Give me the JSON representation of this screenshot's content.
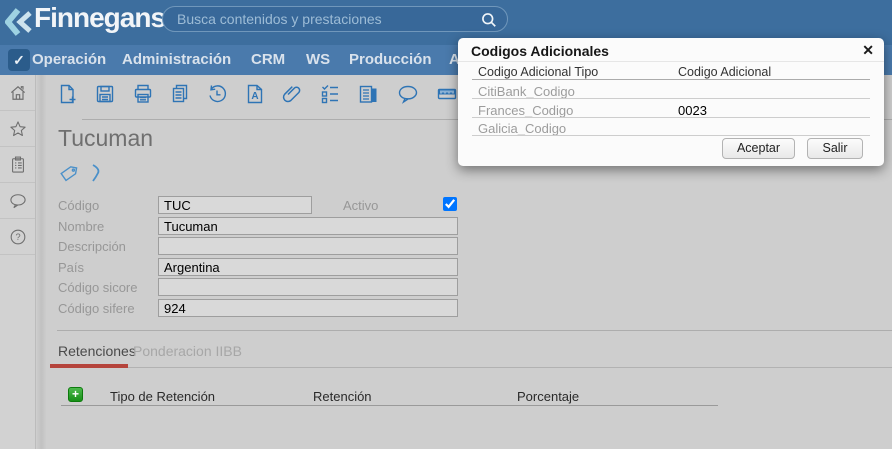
{
  "colors": {
    "header_bg": "#3d6e9e",
    "nav_bg": "#4a7aac",
    "content_bg": "#cecece",
    "toolbar_icon_blue": "#2e74b5",
    "tab_active_underline": "#b5443c",
    "add_button_green": "#2aa22a"
  },
  "glyphs": {
    "check": "✓",
    "plus": "+",
    "close": "✕"
  },
  "header": {
    "logo_text": "Finnegans",
    "search": {
      "placeholder": "Busca contenidos y prestaciones"
    }
  },
  "nav": {
    "items": [
      {
        "label": "Operación"
      },
      {
        "label": "Administración"
      },
      {
        "label": "CRM"
      },
      {
        "label": "WS"
      },
      {
        "label": "Producción"
      },
      {
        "label": "A"
      }
    ]
  },
  "sidebar": {
    "icons": [
      "home",
      "star",
      "tasks",
      "chat",
      "help"
    ]
  },
  "toolbar": {
    "icons": [
      "new-document",
      "save",
      "print",
      "copy",
      "history",
      "font",
      "attachment",
      "checklist",
      "report",
      "comment",
      "ruler"
    ]
  },
  "record": {
    "title": "Tucuman",
    "fields": [
      {
        "label": "Código",
        "value": "TUC"
      },
      {
        "label": "Nombre",
        "value": "Tucuman"
      },
      {
        "label": "Descripción",
        "value": ""
      },
      {
        "label": "País",
        "value": "Argentina"
      },
      {
        "label": "Código sicore",
        "value": ""
      },
      {
        "label": "Código sifere",
        "value": "924"
      }
    ],
    "activo": {
      "label": "Activo",
      "checked": true
    }
  },
  "tabs": [
    {
      "label": "Retenciones",
      "active": true
    },
    {
      "label": "Ponderacion IIBB",
      "active": false
    }
  ],
  "retenciones_table": {
    "headers": [
      "Tipo de Retención",
      "Retención",
      "Porcentaje"
    ]
  },
  "modal": {
    "title": "Codigos Adicionales",
    "columns": [
      "Codigo Adicional Tipo",
      "Codigo Adicional"
    ],
    "rows": [
      {
        "tipo": "CitiBank_Codigo",
        "codigo": ""
      },
      {
        "tipo": "Frances_Codigo",
        "codigo": "0023"
      },
      {
        "tipo": "Galicia_Codigo",
        "codigo": ""
      }
    ],
    "buttons": [
      {
        "label": "Aceptar"
      },
      {
        "label": "Salir"
      }
    ]
  }
}
